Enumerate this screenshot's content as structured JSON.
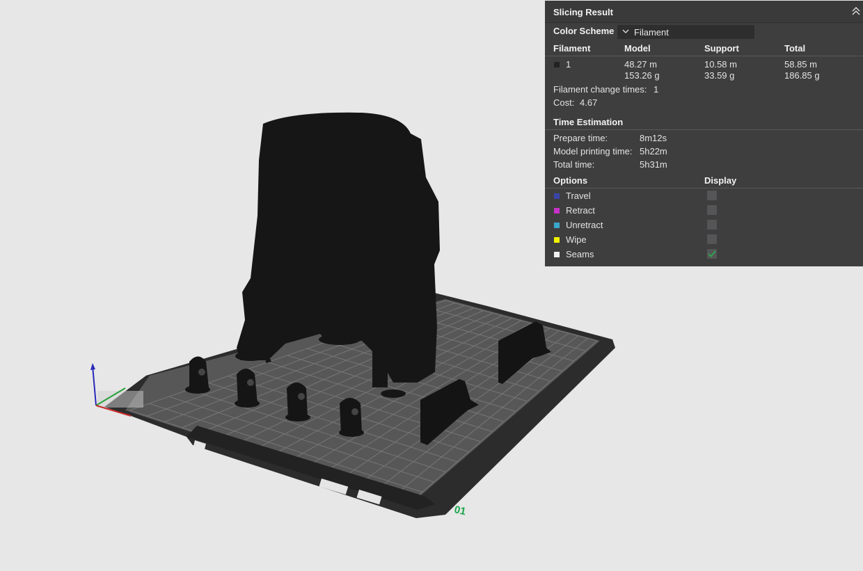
{
  "panel": {
    "title": "Slicing Result",
    "color_scheme_label": "Color Scheme",
    "color_scheme_value": "Filament",
    "table_headers": {
      "filament": "Filament",
      "model": "Model",
      "support": "Support",
      "total": "Total"
    },
    "filament_row": {
      "id": "1",
      "model_length": "48.27 m",
      "model_weight": "153.26 g",
      "support_length": "10.58 m",
      "support_weight": "33.59 g",
      "total_length": "58.85 m",
      "total_weight": "186.85 g",
      "color": "#222222"
    },
    "filament_change_label": "Filament change times:",
    "filament_change_value": "1",
    "cost_label": "Cost:",
    "cost_value": "4.67",
    "time_estimation_title": "Time Estimation",
    "prepare_label": "Prepare time:",
    "prepare_value": "8m12s",
    "model_printing_label": "Model printing time:",
    "model_printing_value": "5h22m",
    "total_time_label": "Total time:",
    "total_time_value": "5h31m",
    "options_header": "Options",
    "display_header": "Display",
    "options": [
      {
        "label": "Travel",
        "color": "#3a45a8",
        "checked": false
      },
      {
        "label": "Retract",
        "color": "#c832c8",
        "checked": false
      },
      {
        "label": "Unretract",
        "color": "#3aa6cc",
        "checked": false
      },
      {
        "label": "Wipe",
        "color": "#f2f200",
        "checked": false
      },
      {
        "label": "Seams",
        "color": "#f0f0f0",
        "checked": true
      }
    ]
  },
  "plate": {
    "plate_number": "01",
    "plate_number_color": "#1aa64a"
  }
}
